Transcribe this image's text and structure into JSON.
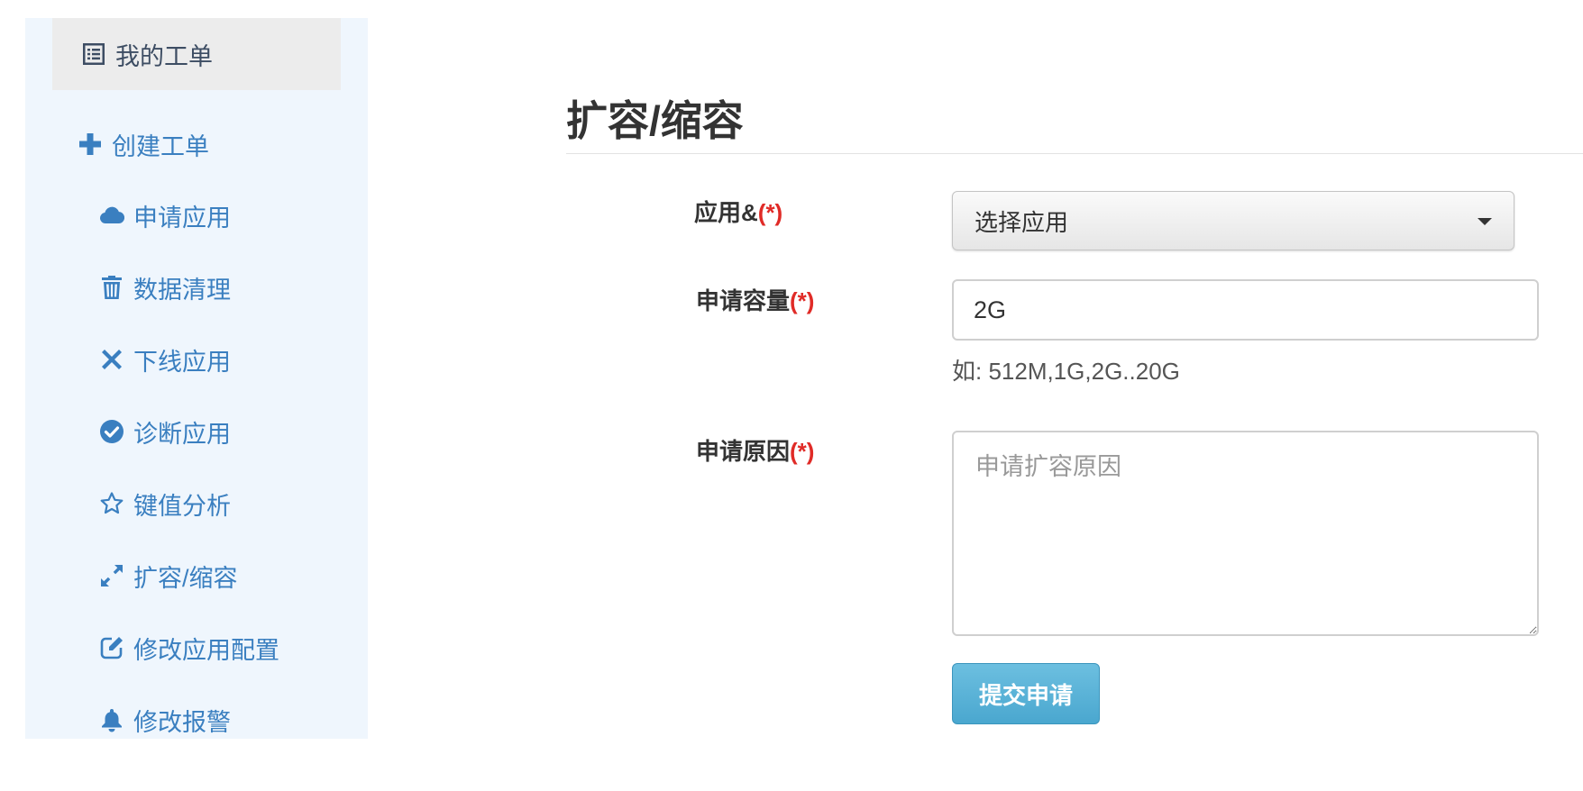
{
  "sidebar": {
    "items": [
      {
        "label": "我的工单",
        "icon": "list-icon",
        "active": true
      },
      {
        "label": "创建工单",
        "icon": "plus-icon"
      },
      {
        "label": "申请应用",
        "icon": "cloud-icon"
      },
      {
        "label": "数据清理",
        "icon": "trash-icon"
      },
      {
        "label": "下线应用",
        "icon": "close-icon"
      },
      {
        "label": "诊断应用",
        "icon": "check-circle-icon"
      },
      {
        "label": "键值分析",
        "icon": "star-icon"
      },
      {
        "label": "扩容/缩容",
        "icon": "resize-icon"
      },
      {
        "label": "修改应用配置",
        "icon": "edit-icon"
      },
      {
        "label": "修改报警",
        "icon": "bell-icon"
      }
    ]
  },
  "main": {
    "title": "扩容/缩容",
    "form": {
      "app_label": "应用&",
      "app_required": "(*)",
      "app_select_value": "选择应用",
      "capacity_label": "申请容量",
      "capacity_required": "(*)",
      "capacity_value": "2G",
      "capacity_help": "如: 512M,1G,2G..20G",
      "reason_label": "申请原因",
      "reason_required": "(*)",
      "reason_placeholder": "申请扩容原因",
      "submit_label": "提交申请"
    }
  },
  "colors": {
    "sidebar_bg": "#eff6fd",
    "link": "#3a7fc0",
    "required": "#e02b27",
    "primary_button": "#5bb4d9"
  }
}
